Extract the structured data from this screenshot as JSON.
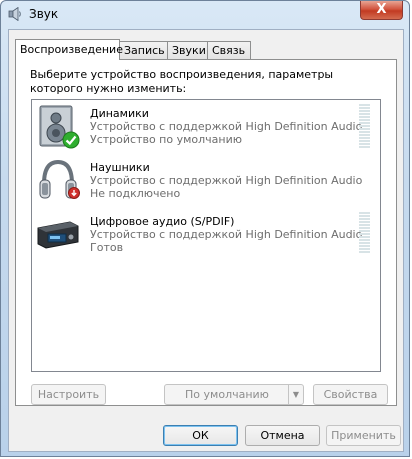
{
  "window": {
    "title": "Звук",
    "close_glyph": "X"
  },
  "tabs": [
    {
      "label": "Воспроизведение",
      "active": true
    },
    {
      "label": "Запись",
      "active": false
    },
    {
      "label": "Звуки",
      "active": false
    },
    {
      "label": "Связь",
      "active": false
    }
  ],
  "playback": {
    "instruction": "Выберите устройство воспроизведения, параметры которого нужно изменить:",
    "devices": [
      {
        "name": "Динамики",
        "description": "Устройство с поддержкой High Definition Audio",
        "status": "Устройство по умолчанию",
        "icon": "speaker-icon",
        "badge": "default-check-icon",
        "meter": true
      },
      {
        "name": "Наушники",
        "description": "Устройство с поддержкой High Definition Audio",
        "status": "Не подключено",
        "icon": "headphones-icon",
        "badge": "unplugged-arrow-icon",
        "meter": false
      },
      {
        "name": "Цифровое аудио (S/PDIF)",
        "description": "Устройство с поддержкой High Definition Audio",
        "status": "Готов",
        "icon": "digital-audio-device-icon",
        "badge": null,
        "meter": true
      }
    ]
  },
  "buttons": {
    "configure": "Настроить",
    "set_default": "По умолчанию",
    "properties": "Свойства",
    "ok": "ОК",
    "cancel": "Отмена",
    "apply": "Применить"
  },
  "colors": {
    "default_badge": "#2fae2f",
    "unplugged_badge": "#d0312d",
    "meter_idle": "#d8e3e6"
  }
}
